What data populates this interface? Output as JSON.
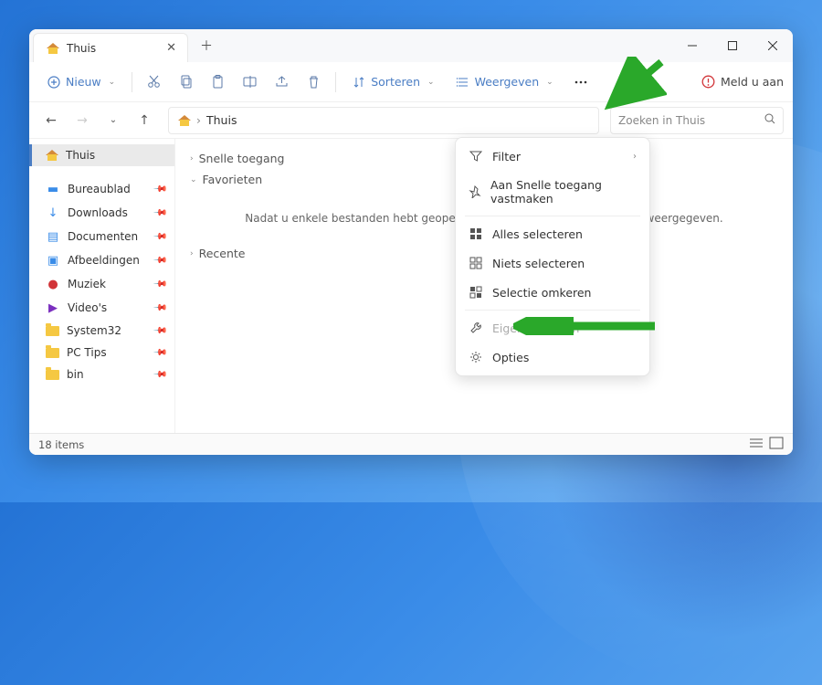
{
  "window": {
    "tab_title": "Thuis"
  },
  "toolbar": {
    "new_label": "Nieuw",
    "sort_label": "Sorteren",
    "view_label": "Weergeven",
    "signin_label": "Meld u aan"
  },
  "breadcrumb": {
    "current": "Thuis"
  },
  "search": {
    "placeholder": "Zoeken in Thuis"
  },
  "sidebar": {
    "home": "Thuis",
    "items": [
      {
        "label": "Bureaublad"
      },
      {
        "label": "Downloads"
      },
      {
        "label": "Documenten"
      },
      {
        "label": "Afbeeldingen"
      },
      {
        "label": "Muziek"
      },
      {
        "label": "Video's"
      },
      {
        "label": "System32"
      },
      {
        "label": "PC Tips"
      },
      {
        "label": "bin"
      }
    ]
  },
  "main": {
    "groups": {
      "quick": "Snelle toegang",
      "fav": "Favorieten",
      "recent": "Recente"
    },
    "empty_msg": "Nadat u enkele bestanden hebt geopend, worden de meest recente hier weergegeven."
  },
  "dropdown": {
    "filter": "Filter",
    "pin": "Aan Snelle toegang vastmaken",
    "select_all": "Alles selecteren",
    "select_none": "Niets selecteren",
    "invert": "Selectie omkeren",
    "properties": "Eigenschappen",
    "options": "Opties"
  },
  "status": {
    "items": "18 items"
  }
}
